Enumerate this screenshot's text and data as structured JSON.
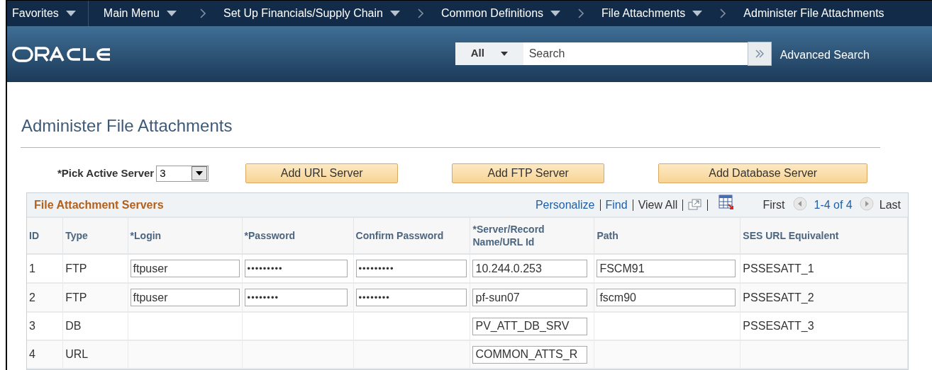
{
  "nav": {
    "favorites": {
      "label": "Favorites",
      "has_menu": true
    },
    "breadcrumbs": [
      {
        "label": "Main Menu",
        "has_menu": true
      },
      {
        "label": "Set Up Financials/Supply Chain",
        "has_menu": true
      },
      {
        "label": "Common Definitions",
        "has_menu": true
      },
      {
        "label": "File Attachments",
        "has_menu": true
      },
      {
        "label": "Administer File Attachments",
        "has_menu": false
      }
    ]
  },
  "search": {
    "scope": "All",
    "placeholder": "Search",
    "advanced_link": "Advanced Search"
  },
  "page_title": "Administer File Attachments",
  "active_server": {
    "label": "*Pick Active Server",
    "value": "3"
  },
  "buttons": [
    "Add URL Server",
    "Add FTP Server",
    "Add Database Server"
  ],
  "grid": {
    "title": "File Attachment Servers",
    "links": [
      "Personalize",
      "Find"
    ],
    "view_all": "View All",
    "pager": {
      "first": "First",
      "range": "1-4 of 4",
      "last": "Last"
    },
    "columns": [
      "ID",
      "Type",
      "*Login",
      "*Password",
      "Confirm Password",
      "*Server/Record Name/URL Id",
      "Path",
      "SES URL Equivalent"
    ],
    "rows": [
      {
        "id": "1",
        "type": "FTP",
        "login": "ftpuser",
        "password": "•••••••••",
        "confirm_password": "•••••••••",
        "server": "10.244.0.253",
        "path": "FSCM91",
        "ses_url": "PSSESATT_1"
      },
      {
        "id": "2",
        "type": "FTP",
        "login": "ftpuser",
        "password": "••••••••",
        "confirm_password": "••••••••",
        "server": "pf-sun07",
        "path": "fscm90",
        "ses_url": "PSSESATT_2"
      },
      {
        "id": "3",
        "type": "DB",
        "server": "PV_ATT_DB_SRV",
        "ses_url": "PSSESATT_3"
      },
      {
        "id": "4",
        "type": "URL",
        "server": "COMMON_ATTS_R"
      }
    ]
  }
}
